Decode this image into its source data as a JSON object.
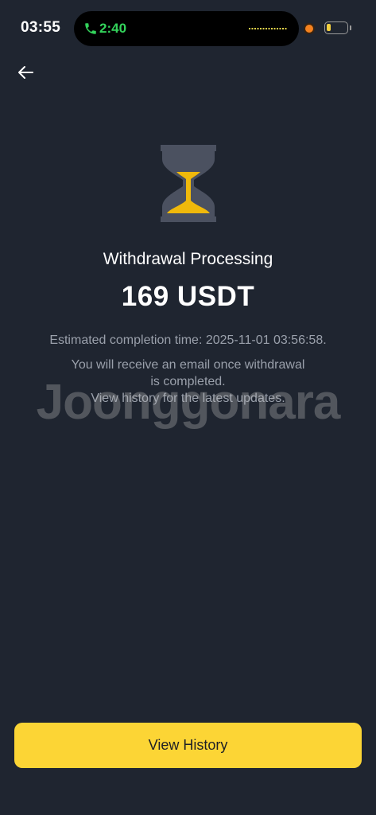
{
  "status_bar": {
    "time": "03:55",
    "call_time": "2:40",
    "call_color": "#33d35b",
    "camera_dot_color": "#f5821f",
    "battery_color": "#f4d03f"
  },
  "header": {
    "back_icon": "arrow-left-icon"
  },
  "status": {
    "icon": "hourglass-icon",
    "title": "Withdrawal Processing",
    "amount": "169 USDT",
    "estimate": "Estimated completion time: 2025-11-01 03:56:58.",
    "notice_line1": "You will receive an email once withdrawal",
    "notice_line2": "is completed.",
    "notice_line3": "View history for the latest updates."
  },
  "watermark": "Joonggonara",
  "footer": {
    "view_history_label": "View History"
  },
  "colors": {
    "background": "#1f2530",
    "accent": "#fcd535",
    "muted_text": "#9aa0ab"
  }
}
